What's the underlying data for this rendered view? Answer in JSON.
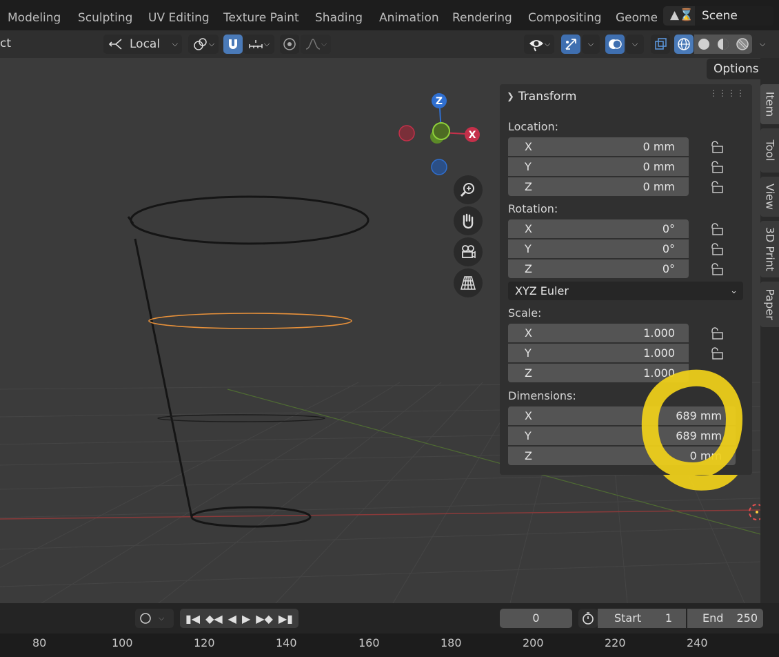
{
  "workspace_tabs": [
    "Modeling",
    "Sculpting",
    "UV Editing",
    "Texture Paint",
    "Shading",
    "Animation",
    "Rendering",
    "Compositing",
    "Geomet"
  ],
  "scene": {
    "name": "Scene"
  },
  "header": {
    "mode_partial": "ct",
    "orientation": "Local",
    "options_label": "Options"
  },
  "panel": {
    "title": "Transform",
    "location_label": "Location:",
    "location": [
      {
        "axis": "X",
        "value": "0 mm"
      },
      {
        "axis": "Y",
        "value": "0 mm"
      },
      {
        "axis": "Z",
        "value": "0 mm"
      }
    ],
    "rotation_label": "Rotation:",
    "rotation": [
      {
        "axis": "X",
        "value": "0°"
      },
      {
        "axis": "Y",
        "value": "0°"
      },
      {
        "axis": "Z",
        "value": "0°"
      }
    ],
    "rotation_mode": "XYZ Euler",
    "scale_label": "Scale:",
    "scale": [
      {
        "axis": "X",
        "value": "1.000"
      },
      {
        "axis": "Y",
        "value": "1.000"
      },
      {
        "axis": "Z",
        "value": "1.000"
      }
    ],
    "dimensions_label": "Dimensions:",
    "dimensions": [
      {
        "axis": "X",
        "value": "689 mm"
      },
      {
        "axis": "Y",
        "value": "689 mm"
      },
      {
        "axis": "Z",
        "value": "0 mm"
      }
    ]
  },
  "side_tabs": [
    "Item",
    "Tool",
    "View",
    "3D Print",
    "Paper"
  ],
  "gizmo": {
    "z": "Z",
    "x": "X"
  },
  "timeline": {
    "current_frame": "0",
    "start_label": "Start",
    "start_value": "1",
    "end_label": "End",
    "end_value": "250"
  },
  "ruler_ticks": [
    "80",
    "100",
    "120",
    "140",
    "160",
    "180",
    "200",
    "220",
    "240"
  ],
  "colors": {
    "accent_blue": "#4a7ab8",
    "highlight_yellow": "#f2d21a",
    "selected_orange": "#e8913a",
    "x_axis": "#c5304a",
    "y_axis": "#7fb32a",
    "z_axis": "#2f6fd0"
  }
}
